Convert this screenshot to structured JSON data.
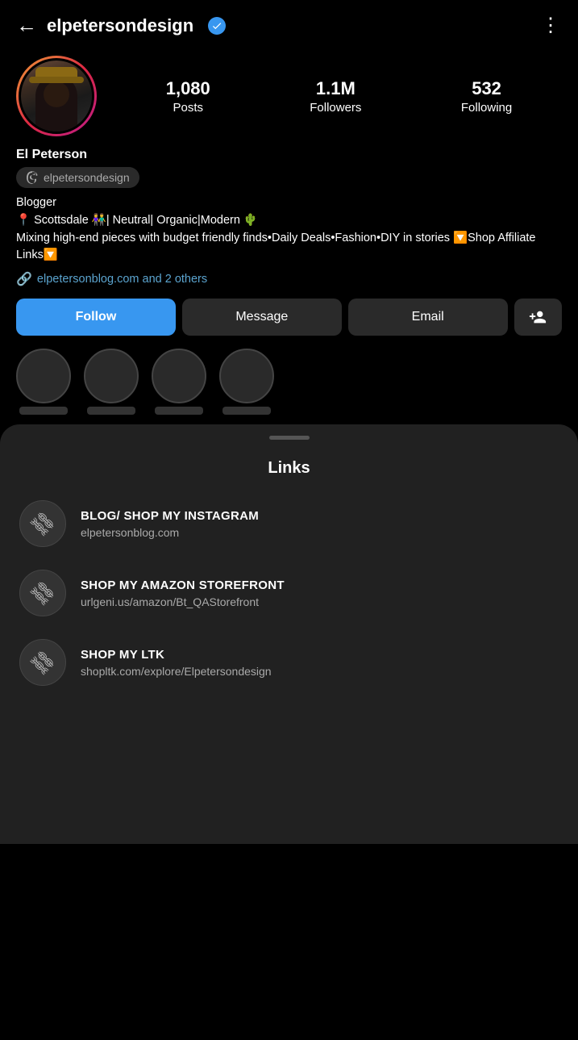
{
  "header": {
    "back_label": "←",
    "username": "elpetersondesign",
    "more_icon": "⋮",
    "verified": true
  },
  "profile": {
    "display_name": "El Peterson",
    "threads_handle": "elpetersondesign",
    "stats": {
      "posts_count": "1,080",
      "posts_label": "Posts",
      "followers_count": "1.1M",
      "followers_label": "Followers",
      "following_count": "532",
      "following_label": "Following"
    },
    "bio": "Blogger\n📍 Scottsdale 👫| Neutral| Organic|Modern 🌵\nMixing high-end pieces with budget friendly finds•Daily Deals•Fashion•DIY in stories 🔽Shop Affiliate Links🔽",
    "link_text": "elpetersonblog.com and 2 others"
  },
  "actions": {
    "follow_label": "Follow",
    "message_label": "Message",
    "email_label": "Email",
    "add_friend_icon": "+👤"
  },
  "bottom_sheet": {
    "title": "Links",
    "links": [
      {
        "title": "BLOG/ SHOP MY INSTAGRAM",
        "url": "elpetersonblog.com"
      },
      {
        "title": "SHOP MY AMAZON STOREFRONT",
        "url": "urlgeni.us/amazon/Bt_QAStorefront"
      },
      {
        "title": "SHOP MY LTK",
        "url": "shopltk.com/explore/Elpetersondesign"
      }
    ]
  }
}
